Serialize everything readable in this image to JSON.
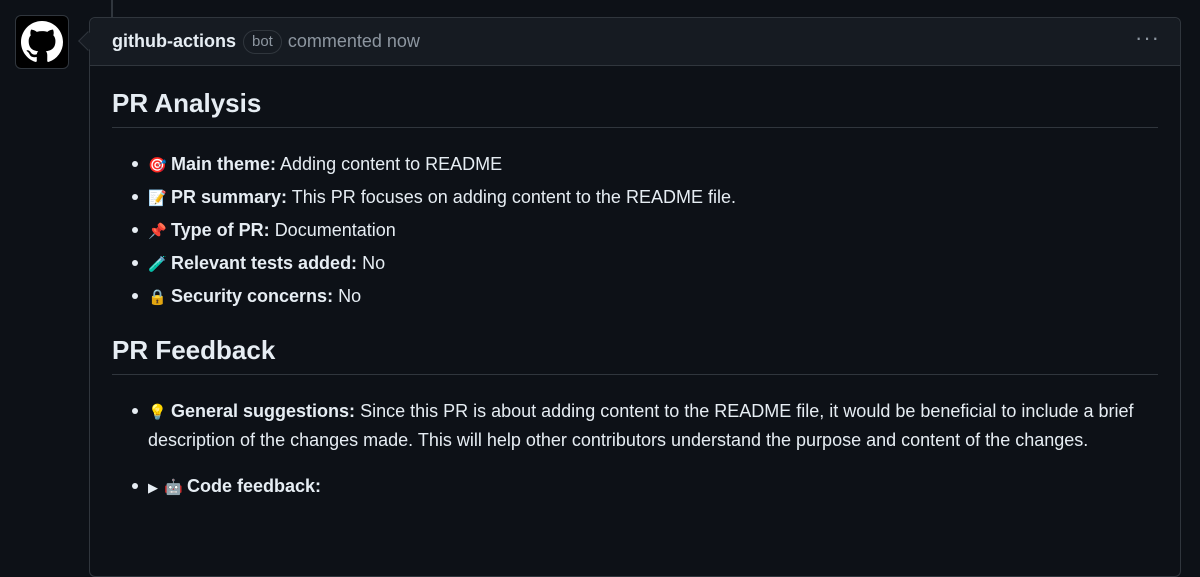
{
  "comment": {
    "author": "github-actions",
    "badge": "bot",
    "timestamp": "commented now",
    "more_label": "···"
  },
  "analysis": {
    "title": "PR Analysis",
    "items": [
      {
        "icon": "target-icon",
        "emoji": "🎯",
        "label": "Main theme:",
        "value": "Adding content to README"
      },
      {
        "icon": "memo-icon",
        "emoji": "📝",
        "label": "PR summary:",
        "value": "This PR focuses on adding content to the README file."
      },
      {
        "icon": "pushpin-icon",
        "emoji": "📌",
        "label": "Type of PR:",
        "value": "Documentation"
      },
      {
        "icon": "test-tube-icon",
        "emoji": "🧪",
        "label": "Relevant tests added:",
        "value": "No"
      },
      {
        "icon": "lock-icon",
        "emoji": "🔒",
        "label": "Security concerns:",
        "value": "No"
      }
    ]
  },
  "feedback": {
    "title": "PR Feedback",
    "general": {
      "icon": "light-bulb-icon",
      "emoji": "💡",
      "label": "General suggestions:",
      "value": "Since this PR is about adding content to the README file, it would be beneficial to include a brief description of the changes made. This will help other contributors understand the purpose and content of the changes."
    },
    "code": {
      "toggle": "▶",
      "icon": "robot-icon",
      "emoji": "🤖",
      "label": "Code feedback:"
    }
  }
}
